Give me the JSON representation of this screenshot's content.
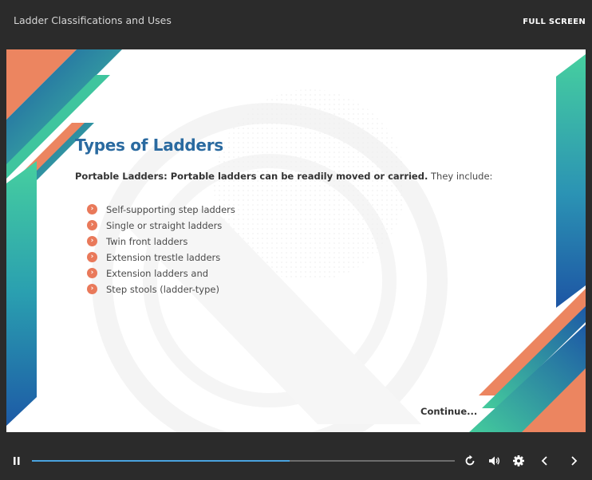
{
  "course": {
    "title": "Ladder Classifications and Uses",
    "fullscreen_label": "FULL SCREEN"
  },
  "slide": {
    "heading": "Types of Ladders",
    "intro_bold": "Portable Ladders: Portable ladders can be readily moved or carried.",
    "intro_rest": " They include:",
    "items": [
      "Self-supporting step ladders",
      "Single or straight ladders",
      "Twin front ladders",
      "Extension trestle ladders",
      "Extension ladders and",
      "Step stools (ladder-type)"
    ],
    "continue_label": "Continue..."
  },
  "playback": {
    "progress_fraction": 0.61
  },
  "icons": {
    "pause": "pause-icon",
    "replay": "replay-icon",
    "volume": "volume-icon",
    "settings": "gear-icon",
    "prev": "chevron-left-icon",
    "next": "chevron-right-icon",
    "bullet": "chevron-right-circle-icon"
  },
  "colors": {
    "heading": "#2a6aa0",
    "accent_orange": "#e9795a",
    "accent_teal": "#3fbf9b",
    "accent_blue": "#1e5fa8",
    "progress": "#4aa3df"
  }
}
